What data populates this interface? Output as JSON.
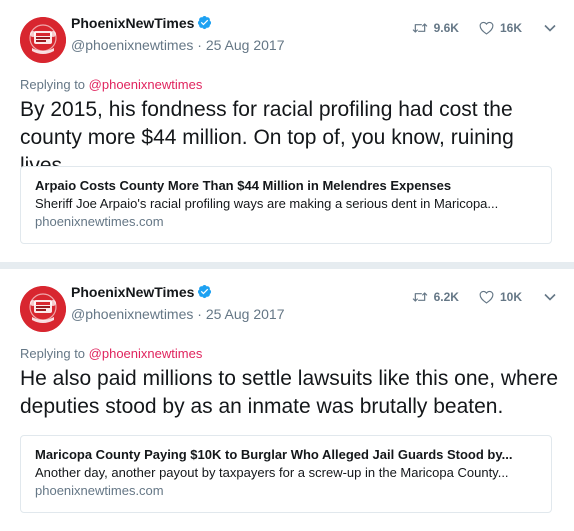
{
  "colors": {
    "background": "#e6ecf0",
    "card_bg": "#ffffff",
    "text": "#14171a",
    "muted": "#657786",
    "mention": "#e0245e",
    "verified": "#1da1f2",
    "avatar_bg": "#d8262f"
  },
  "tweets": [
    {
      "author_name": "PhoenixNewTimes",
      "handle": "@phoenixnewtimes",
      "date": "25 Aug 2017",
      "retweets": "9.6K",
      "likes": "16K",
      "reply_prefix": "Replying to",
      "reply_to": "@phoenixnewtimes",
      "text": "By 2015, his fondness for racial profiling had cost the county more $44 million. On top of, you know, ruining lives.",
      "card": {
        "title": "Arpaio Costs County More Than $44 Million in Melendres Expenses",
        "description": "Sheriff Joe Arpaio's racial profiling ways are making a serious dent in Maricopa...",
        "domain": "phoenixnewtimes.com"
      }
    },
    {
      "author_name": "PhoenixNewTimes",
      "handle": "@phoenixnewtimes",
      "date": "25 Aug 2017",
      "retweets": "6.2K",
      "likes": "10K",
      "reply_prefix": "Replying to",
      "reply_to": "@phoenixnewtimes",
      "text": "He also paid millions to settle lawsuits like this one, where deputies stood by as an inmate was brutally beaten.",
      "card": {
        "title": "Maricopa County Paying $10K to Burglar Who Alleged Jail Guards Stood by...",
        "description": "Another day, another payout by taxpayers for a screw-up in the Maricopa County...",
        "domain": "phoenixnewtimes.com"
      }
    }
  ],
  "icons": {
    "retweet": "retweet-icon",
    "like": "heart-icon",
    "more": "chevron-down-icon",
    "verified": "verified-badge-icon",
    "avatar": "phoenix-new-times-logo"
  }
}
